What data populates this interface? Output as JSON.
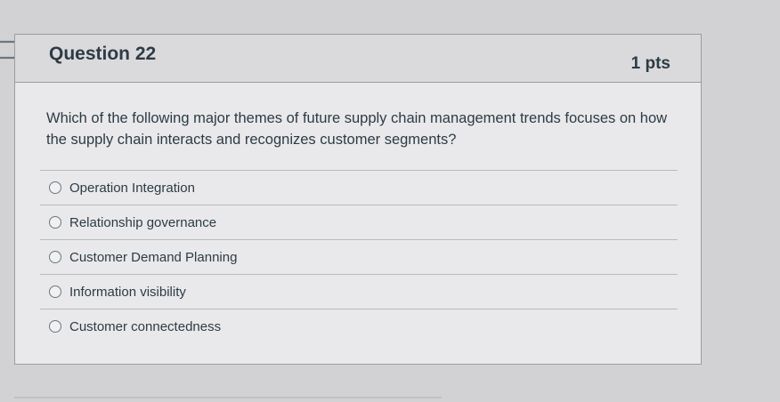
{
  "question": {
    "title": "Question 22",
    "points": "1 pts",
    "text": "Which of the following major themes of future supply chain management trends focuses on how the supply chain interacts and recognizes customer segments?"
  },
  "answers": [
    {
      "label": "Operation Integration"
    },
    {
      "label": "Relationship governance"
    },
    {
      "label": "Customer Demand Planning"
    },
    {
      "label": "Information visibility"
    },
    {
      "label": "Customer connectedness"
    }
  ],
  "colors": {
    "background": "#d2d2d4",
    "card": "#e9e9eb",
    "header": "#dadadc",
    "text": "#2d3b45"
  },
  "icons": [
    "bookmark-flag-icon",
    "radio-unselected-icon"
  ]
}
